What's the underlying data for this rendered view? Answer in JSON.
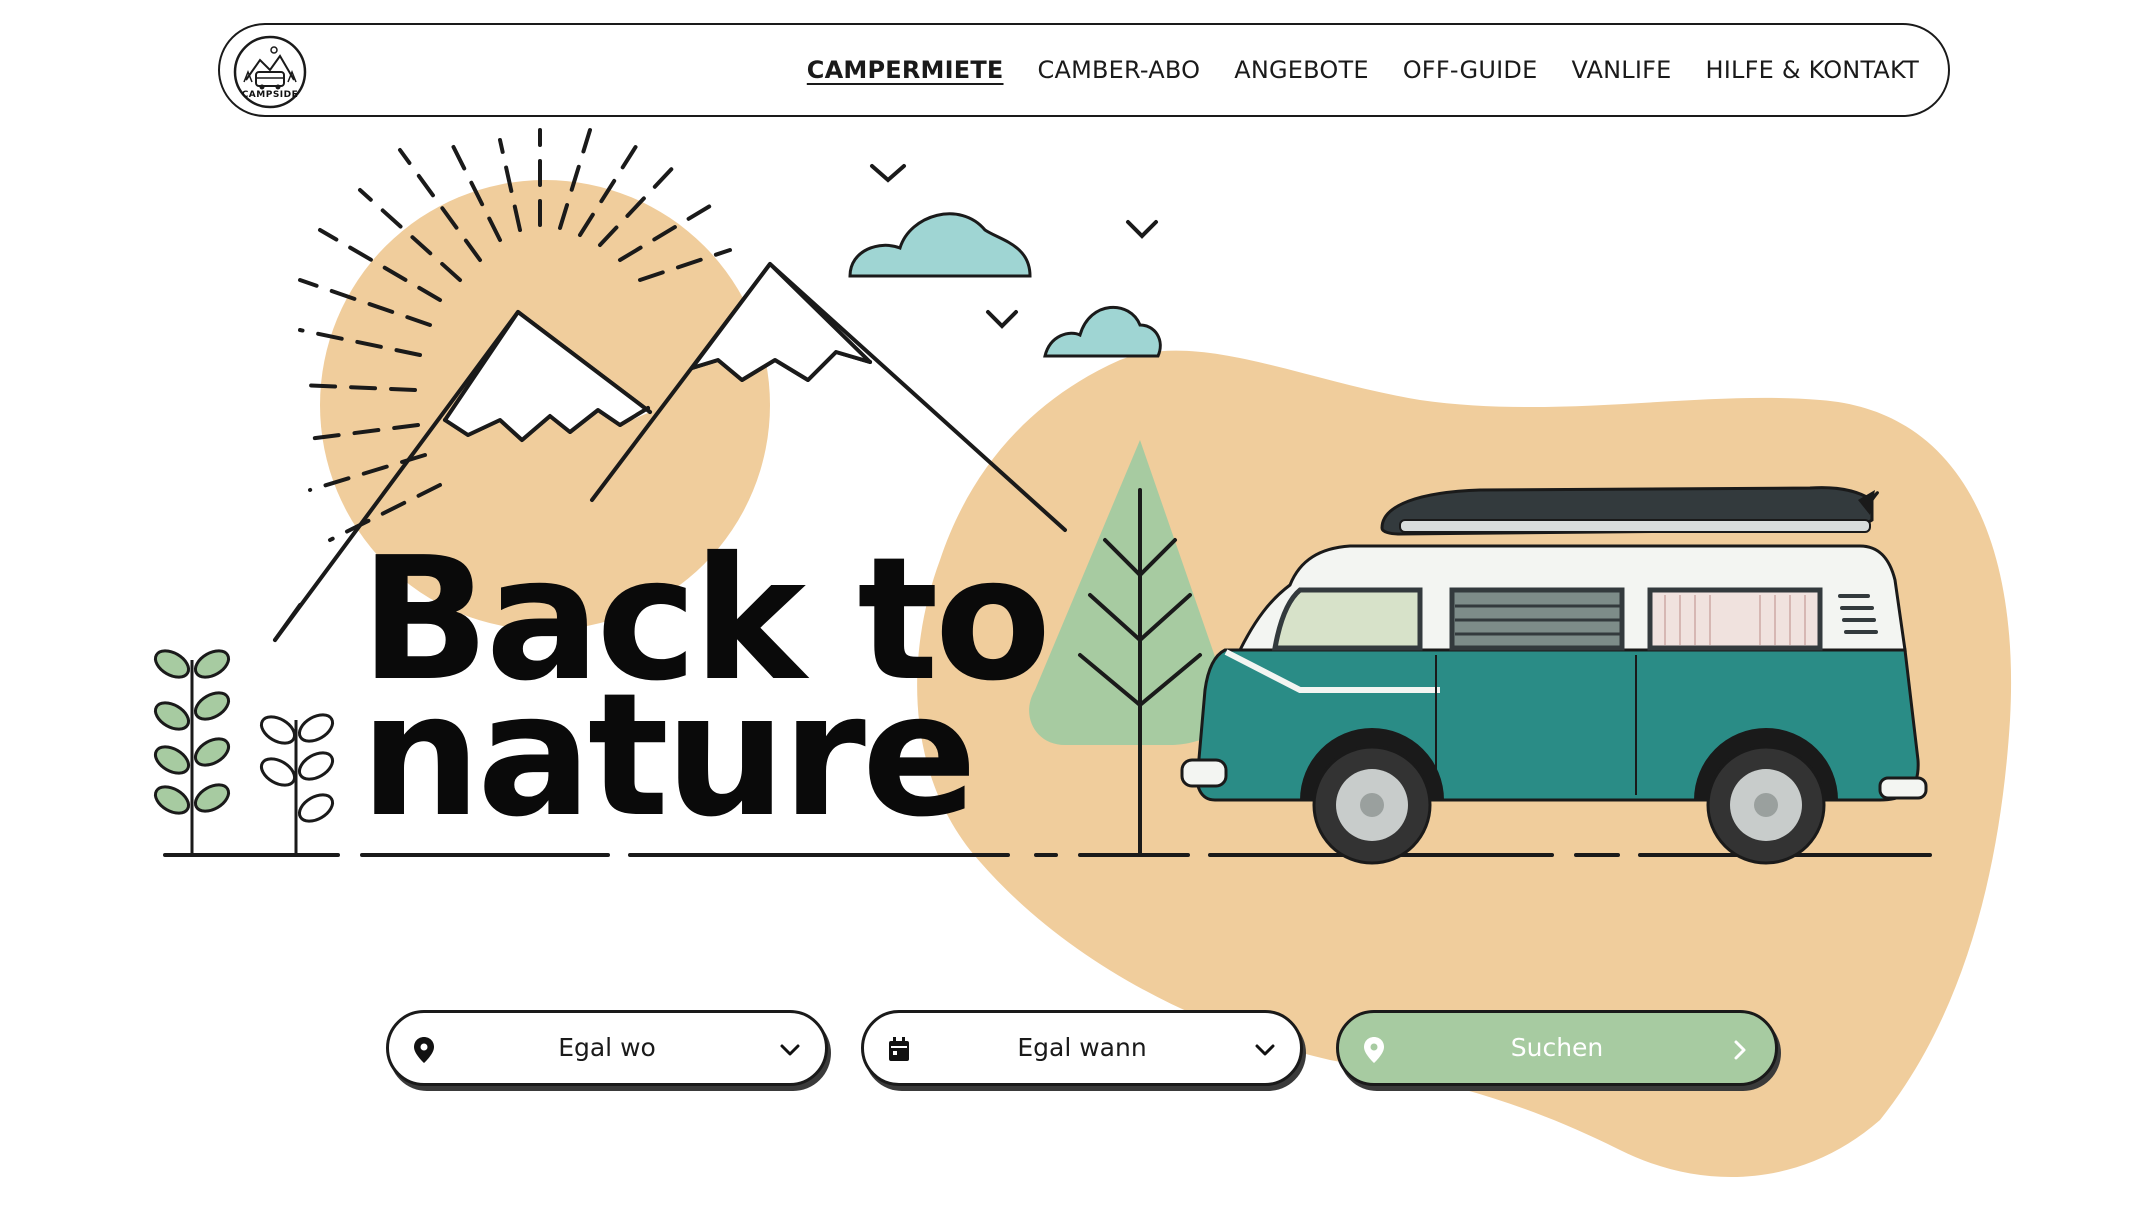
{
  "brand": {
    "name": "CAMPSIDE"
  },
  "nav": {
    "items": [
      {
        "label": "CAMPERMIETE",
        "active": true
      },
      {
        "label": "CAMBER-ABO",
        "active": false
      },
      {
        "label": "ANGEBOTE",
        "active": false
      },
      {
        "label": "OFF-GUIDE",
        "active": false
      },
      {
        "label": "VANLIFE",
        "active": false
      },
      {
        "label": "HILFE & KONTAKT",
        "active": false
      }
    ]
  },
  "hero": {
    "line1": "Back to",
    "line2": "nature"
  },
  "search": {
    "location_label": "Egal wo",
    "date_label": "Egal wann",
    "submit_label": "Suchen",
    "location_icon": "map-pin-icon",
    "date_icon": "calendar-icon",
    "dropdown_icon": "chevron-down-icon",
    "submit_icon": "chevron-right-icon"
  },
  "colors": {
    "sand": "#f0cd9c",
    "sage": "#a7cba1",
    "cloud": "#9fd5d3",
    "van_teal": "#2a8c86",
    "ink": "#1a1a1a"
  }
}
